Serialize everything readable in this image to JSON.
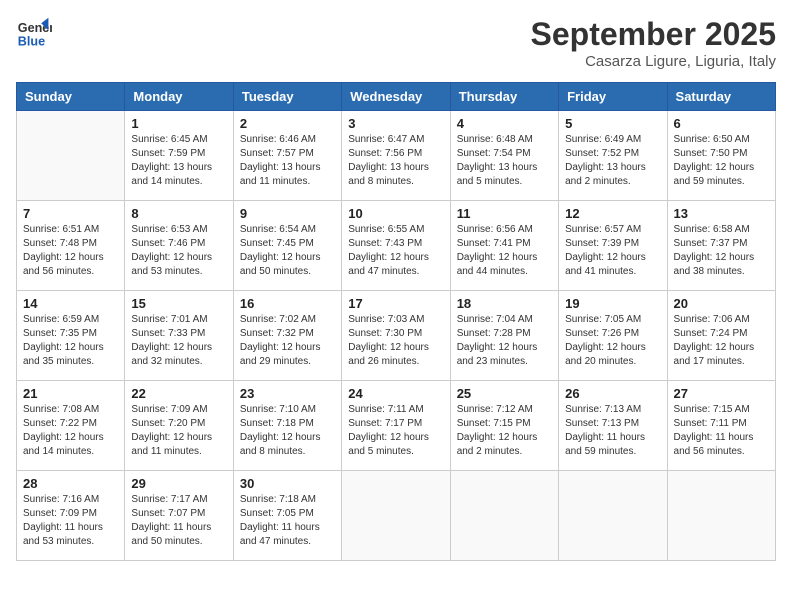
{
  "logo": {
    "line1": "General",
    "line2": "Blue"
  },
  "title": "September 2025",
  "subtitle": "Casarza Ligure, Liguria, Italy",
  "days_header": [
    "Sunday",
    "Monday",
    "Tuesday",
    "Wednesday",
    "Thursday",
    "Friday",
    "Saturday"
  ],
  "weeks": [
    [
      {
        "num": "",
        "info": ""
      },
      {
        "num": "1",
        "info": "Sunrise: 6:45 AM\nSunset: 7:59 PM\nDaylight: 13 hours\nand 14 minutes."
      },
      {
        "num": "2",
        "info": "Sunrise: 6:46 AM\nSunset: 7:57 PM\nDaylight: 13 hours\nand 11 minutes."
      },
      {
        "num": "3",
        "info": "Sunrise: 6:47 AM\nSunset: 7:56 PM\nDaylight: 13 hours\nand 8 minutes."
      },
      {
        "num": "4",
        "info": "Sunrise: 6:48 AM\nSunset: 7:54 PM\nDaylight: 13 hours\nand 5 minutes."
      },
      {
        "num": "5",
        "info": "Sunrise: 6:49 AM\nSunset: 7:52 PM\nDaylight: 13 hours\nand 2 minutes."
      },
      {
        "num": "6",
        "info": "Sunrise: 6:50 AM\nSunset: 7:50 PM\nDaylight: 12 hours\nand 59 minutes."
      }
    ],
    [
      {
        "num": "7",
        "info": "Sunrise: 6:51 AM\nSunset: 7:48 PM\nDaylight: 12 hours\nand 56 minutes."
      },
      {
        "num": "8",
        "info": "Sunrise: 6:53 AM\nSunset: 7:46 PM\nDaylight: 12 hours\nand 53 minutes."
      },
      {
        "num": "9",
        "info": "Sunrise: 6:54 AM\nSunset: 7:45 PM\nDaylight: 12 hours\nand 50 minutes."
      },
      {
        "num": "10",
        "info": "Sunrise: 6:55 AM\nSunset: 7:43 PM\nDaylight: 12 hours\nand 47 minutes."
      },
      {
        "num": "11",
        "info": "Sunrise: 6:56 AM\nSunset: 7:41 PM\nDaylight: 12 hours\nand 44 minutes."
      },
      {
        "num": "12",
        "info": "Sunrise: 6:57 AM\nSunset: 7:39 PM\nDaylight: 12 hours\nand 41 minutes."
      },
      {
        "num": "13",
        "info": "Sunrise: 6:58 AM\nSunset: 7:37 PM\nDaylight: 12 hours\nand 38 minutes."
      }
    ],
    [
      {
        "num": "14",
        "info": "Sunrise: 6:59 AM\nSunset: 7:35 PM\nDaylight: 12 hours\nand 35 minutes."
      },
      {
        "num": "15",
        "info": "Sunrise: 7:01 AM\nSunset: 7:33 PM\nDaylight: 12 hours\nand 32 minutes."
      },
      {
        "num": "16",
        "info": "Sunrise: 7:02 AM\nSunset: 7:32 PM\nDaylight: 12 hours\nand 29 minutes."
      },
      {
        "num": "17",
        "info": "Sunrise: 7:03 AM\nSunset: 7:30 PM\nDaylight: 12 hours\nand 26 minutes."
      },
      {
        "num": "18",
        "info": "Sunrise: 7:04 AM\nSunset: 7:28 PM\nDaylight: 12 hours\nand 23 minutes."
      },
      {
        "num": "19",
        "info": "Sunrise: 7:05 AM\nSunset: 7:26 PM\nDaylight: 12 hours\nand 20 minutes."
      },
      {
        "num": "20",
        "info": "Sunrise: 7:06 AM\nSunset: 7:24 PM\nDaylight: 12 hours\nand 17 minutes."
      }
    ],
    [
      {
        "num": "21",
        "info": "Sunrise: 7:08 AM\nSunset: 7:22 PM\nDaylight: 12 hours\nand 14 minutes."
      },
      {
        "num": "22",
        "info": "Sunrise: 7:09 AM\nSunset: 7:20 PM\nDaylight: 12 hours\nand 11 minutes."
      },
      {
        "num": "23",
        "info": "Sunrise: 7:10 AM\nSunset: 7:18 PM\nDaylight: 12 hours\nand 8 minutes."
      },
      {
        "num": "24",
        "info": "Sunrise: 7:11 AM\nSunset: 7:17 PM\nDaylight: 12 hours\nand 5 minutes."
      },
      {
        "num": "25",
        "info": "Sunrise: 7:12 AM\nSunset: 7:15 PM\nDaylight: 12 hours\nand 2 minutes."
      },
      {
        "num": "26",
        "info": "Sunrise: 7:13 AM\nSunset: 7:13 PM\nDaylight: 11 hours\nand 59 minutes."
      },
      {
        "num": "27",
        "info": "Sunrise: 7:15 AM\nSunset: 7:11 PM\nDaylight: 11 hours\nand 56 minutes."
      }
    ],
    [
      {
        "num": "28",
        "info": "Sunrise: 7:16 AM\nSunset: 7:09 PM\nDaylight: 11 hours\nand 53 minutes."
      },
      {
        "num": "29",
        "info": "Sunrise: 7:17 AM\nSunset: 7:07 PM\nDaylight: 11 hours\nand 50 minutes."
      },
      {
        "num": "30",
        "info": "Sunrise: 7:18 AM\nSunset: 7:05 PM\nDaylight: 11 hours\nand 47 minutes."
      },
      {
        "num": "",
        "info": ""
      },
      {
        "num": "",
        "info": ""
      },
      {
        "num": "",
        "info": ""
      },
      {
        "num": "",
        "info": ""
      }
    ]
  ]
}
